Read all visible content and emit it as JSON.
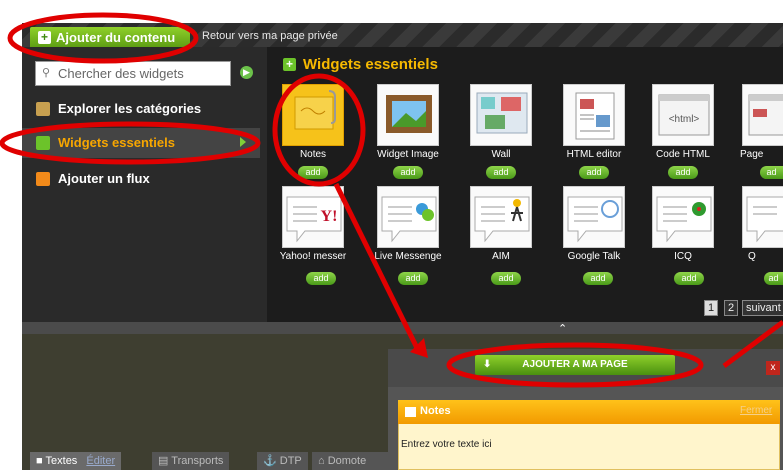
{
  "topbar": {
    "add_content_label": "Ajouter du contenu",
    "back_link": "Retour vers ma page privée"
  },
  "sidebar": {
    "search_placeholder": "Chercher des widgets",
    "items": [
      {
        "label": "Explorer les catégories"
      },
      {
        "label": "Widgets essentiels"
      },
      {
        "label": "Ajouter un flux"
      }
    ]
  },
  "widgets": {
    "title": "Widgets essentiels",
    "row1": [
      {
        "label": "Notes",
        "add": "add"
      },
      {
        "label": "Widget Image",
        "add": "add"
      },
      {
        "label": "Wall",
        "add": "add"
      },
      {
        "label": "HTML editor",
        "add": "add"
      },
      {
        "label": "Code HTML",
        "add": "add"
      },
      {
        "label": "Page",
        "add": "ad"
      }
    ],
    "row2": [
      {
        "label": "Yahoo! messer",
        "add": "add"
      },
      {
        "label": "Live Messenge",
        "add": "add"
      },
      {
        "label": "AIM",
        "add": "add"
      },
      {
        "label": "Google Talk",
        "add": "add"
      },
      {
        "label": "ICQ",
        "add": "add"
      },
      {
        "label": "Q",
        "add": "ad"
      }
    ],
    "html_tile_text": "<html>",
    "pager": {
      "page1": "1",
      "page2": "2",
      "next": "suivant"
    }
  },
  "popup": {
    "add_to_page_label": "AJOUTER A MA PAGE",
    "close": "x",
    "notes_title": "Notes",
    "notes_link": "Fermer",
    "notes_placeholder": "Entrez votre texte ici"
  },
  "bottom_tabs": [
    {
      "label": "Textes",
      "edit": "Éditer"
    },
    {
      "label": "Transports"
    },
    {
      "label": "DTP"
    },
    {
      "label": "Domote"
    }
  ],
  "colors": {
    "accent_green": "#6cc32a",
    "accent_orange": "#f7a600",
    "annotation_red": "#e00000"
  }
}
